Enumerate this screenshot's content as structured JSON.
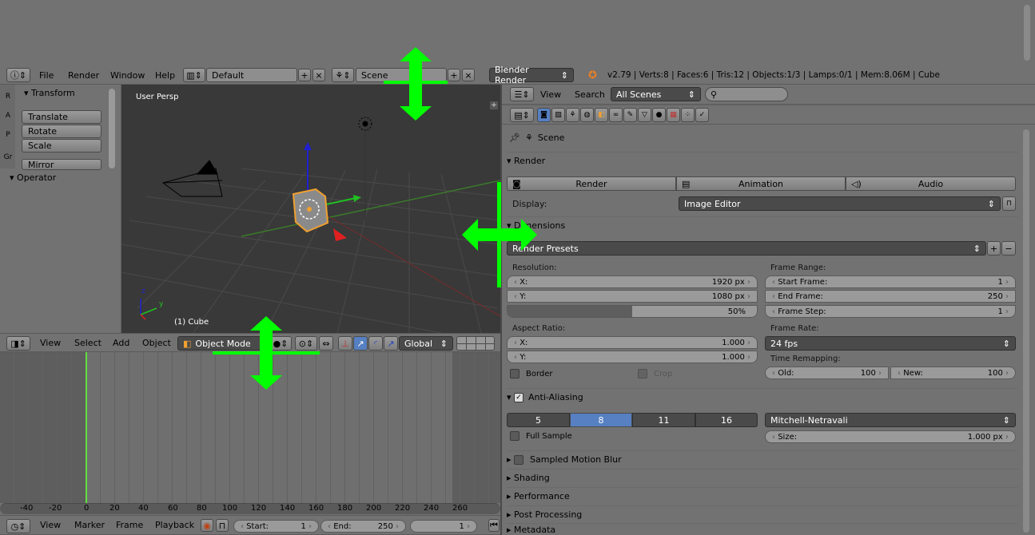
{
  "info_header": {
    "menus": [
      "File",
      "Render",
      "Window",
      "Help"
    ],
    "layout": "Default",
    "scene": "Scene",
    "engine": "Blender Render",
    "stats": "v2.79 | Verts:8 | Faces:6 | Tris:12 | Objects:1/3 | Lamps:0/1 | Mem:8.06M | Cube"
  },
  "toolshelf": {
    "tabs": [
      "R",
      "A",
      "P",
      "Gr"
    ],
    "transform_title": "Transform",
    "buttons": [
      "Translate",
      "Rotate",
      "Scale",
      "Mirror"
    ],
    "operator_title": "Operator"
  },
  "viewport": {
    "view_label": "User Persp",
    "object_label": "(1) Cube",
    "axis_z": "z",
    "axis_y": "y"
  },
  "view3d_header": {
    "menus": [
      "View",
      "Select",
      "Add",
      "Object"
    ],
    "mode": "Object Mode",
    "orientation": "Global"
  },
  "timeline": {
    "ruler": [
      "-40",
      "-20",
      "0",
      "20",
      "40",
      "60",
      "80",
      "100",
      "120",
      "140",
      "160",
      "180",
      "200",
      "220",
      "240",
      "260"
    ],
    "menus": [
      "View",
      "Marker",
      "Frame",
      "Playback"
    ],
    "start_label": "Start:",
    "start_value": "1",
    "end_label": "End:",
    "end_value": "250",
    "current": "1"
  },
  "outliner_header": {
    "view": "View",
    "search": "Search",
    "scenes": "All Scenes"
  },
  "properties": {
    "breadcrumb": "Scene",
    "render_panel": {
      "title": "Render",
      "buttons": [
        "Render",
        "Animation",
        "Audio"
      ],
      "display_label": "Display:",
      "display_value": "Image Editor"
    },
    "dimensions_panel": {
      "title": "Dimensions",
      "presets": "Render Presets",
      "resolution_label": "Resolution:",
      "res_x_label": "X:",
      "res_x": "1920 px",
      "res_y_label": "Y:",
      "res_y": "1080 px",
      "res_pct": "50%",
      "res_pct_fill": 0.5,
      "aspect_label": "Aspect Ratio:",
      "aspect_x_label": "X:",
      "aspect_x": "1.000",
      "aspect_y_label": "Y:",
      "aspect_y": "1.000",
      "border": "Border",
      "crop": "Crop",
      "frame_range_label": "Frame Range:",
      "start_label": "Start Frame:",
      "start": "1",
      "end_label": "End Frame:",
      "end": "250",
      "step_label": "Frame Step:",
      "step": "1",
      "frame_rate_label": "Frame Rate:",
      "frame_rate": "24 fps",
      "remap_label": "Time Remapping:",
      "old_label": "Old:",
      "old": "100",
      "new_label": "New:",
      "new": "100"
    },
    "aa_panel": {
      "title": "Anti-Aliasing",
      "samples": [
        "5",
        "8",
        "11",
        "16"
      ],
      "selected_sample": "8",
      "filter": "Mitchell-Netravali",
      "full_sample": "Full Sample",
      "size_label": "Size:",
      "size": "1.000 px"
    },
    "collapsed": [
      "Sampled Motion Blur",
      "Shading",
      "Performance",
      "Post Processing",
      "Metadata"
    ]
  },
  "colors": {
    "accent": "#5680c2",
    "arrow": "#00ff00",
    "bg": "#727272",
    "viewport": "#393939"
  }
}
